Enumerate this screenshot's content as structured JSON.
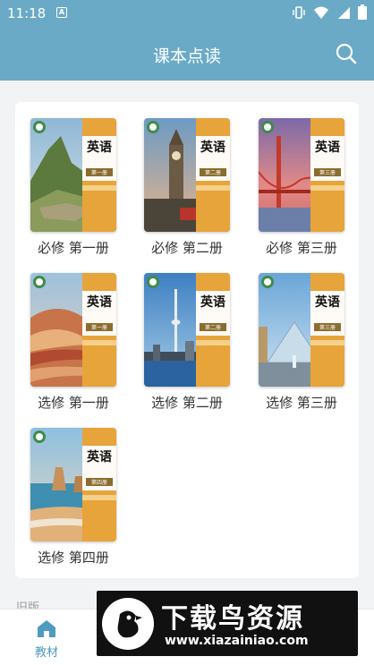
{
  "status_bar": {
    "time": "11:18",
    "app_icon_letter": "A"
  },
  "header": {
    "title": "课本点读",
    "search_icon": "search-icon"
  },
  "books": [
    {
      "label": "必修 第一册",
      "cover_title": "英语",
      "cover_scene": "mountain-ruins",
      "badge": "第一册"
    },
    {
      "label": "必修 第二册",
      "cover_title": "英语",
      "cover_scene": "clock-tower",
      "badge": "第二册"
    },
    {
      "label": "必修 第三册",
      "cover_title": "英语",
      "cover_scene": "red-bridge",
      "badge": "第三册"
    },
    {
      "label": "选修 第一册",
      "cover_title": "英语",
      "cover_scene": "striped-hills",
      "badge": "第一册"
    },
    {
      "label": "选修 第二册",
      "cover_title": "英语",
      "cover_scene": "tower-skyline",
      "badge": "第二册"
    },
    {
      "label": "选修 第三册",
      "cover_title": "英语",
      "cover_scene": "glass-pyramid",
      "badge": "第三册"
    },
    {
      "label": "选修 第四册",
      "cover_title": "英语",
      "cover_scene": "sea-cliffs",
      "badge": "第四册"
    }
  ],
  "section_peek": "旧版",
  "bottom_nav": {
    "items": [
      {
        "label": "教材",
        "icon": "home-icon",
        "active": true
      }
    ]
  },
  "ad": {
    "title": "下载鸟资源",
    "url": "www.xiazainiao.com"
  },
  "colors": {
    "primary": "#6aaac7",
    "nav_active": "#4f9ac0",
    "background": "#f2f3f5"
  }
}
